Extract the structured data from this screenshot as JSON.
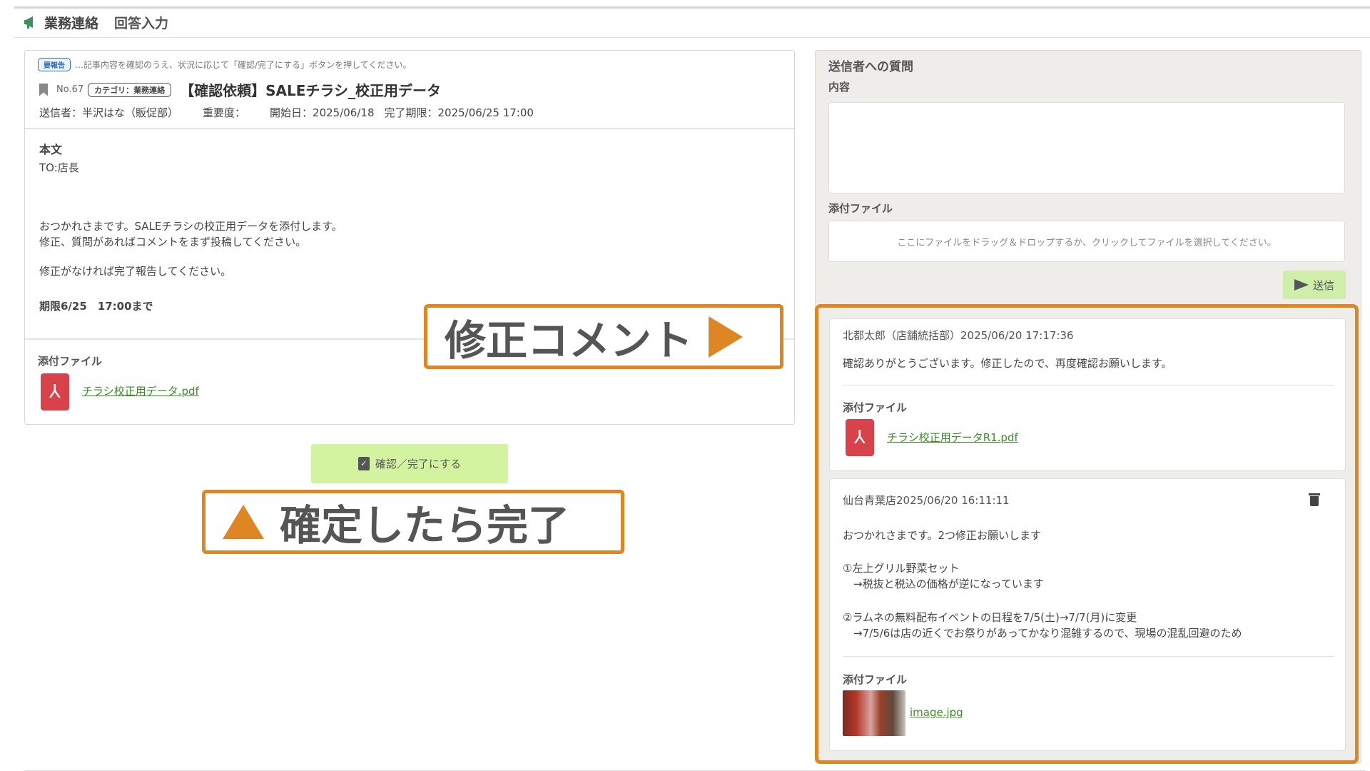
{
  "header": {
    "title": "業務連絡",
    "subtitle": "回答入力"
  },
  "notice": {
    "badge": "要報告",
    "hint": "…記事内容を確認のうえ、状況に応じて「確認/完了にする」ボタンを押してください。"
  },
  "message": {
    "number": "No.67",
    "category": "カテゴリ：業務連絡",
    "title": "【確認依頼】SALEチラシ_校正用データ",
    "sender": "送信者：半沢はな（販促部）",
    "priority": "重要度：",
    "start_date": "開始日：2025/06/18",
    "deadline": "完了期限：2025/06/25 17:00",
    "body_label": "本文",
    "body_lines": [
      "TO:店長",
      "おつかれさまです。SALEチラシの校正用データを添付します。",
      "修正、質問があればコメントをまず投稿してください。",
      "修正がなければ完了報告してください。",
      "期限6/25　17:00まで"
    ],
    "attachment_label": "添付ファイル",
    "attachment_file": "チラシ校正用データ.pdf"
  },
  "confirm_button": "確認／完了にする",
  "callouts": {
    "right": "修正コメント",
    "left": "確定したら完了"
  },
  "question_panel": {
    "title": "送信者への質問",
    "content_label": "内容",
    "content_value": "",
    "attachment_label": "添付ファイル",
    "dropzone_text": "ここにファイルをドラッグ＆ドロップするか、クリックしてファイルを選択してください。",
    "send_label": "送信"
  },
  "comments": [
    {
      "author_time": "北都太郎（店舗統括部）2025/06/20 17:17:36",
      "lines": [
        "確認ありがとうございます。修正したので、再度確認お願いします。"
      ],
      "attachment_label": "添付ファイル",
      "attachment_file": "チラシ校正用データR1.pdf"
    },
    {
      "author_time": "仙台青葉店2025/06/20 16:11:11",
      "lines": [
        "おつかれさまです。2つ修正お願いします",
        "①左上グリル野菜セット",
        "　→税抜と税込の価格が逆になっています",
        "②ラムネの無料配布イベントの日程を7/5(土)→7/7(月)に変更",
        "　→7/5/6は店の近くでお祭りがあってかなり混雑するので、現場の混乱回避のため"
      ],
      "attachment_label": "添付ファイル",
      "attachment_file": "image.jpg"
    }
  ],
  "colors": {
    "accent_orange": "#de8624",
    "link_green": "#3b8d28",
    "button_green": "#d4f3a1",
    "pdf_red": "#d8434b",
    "megaphone_green": "#3f8f5f"
  }
}
